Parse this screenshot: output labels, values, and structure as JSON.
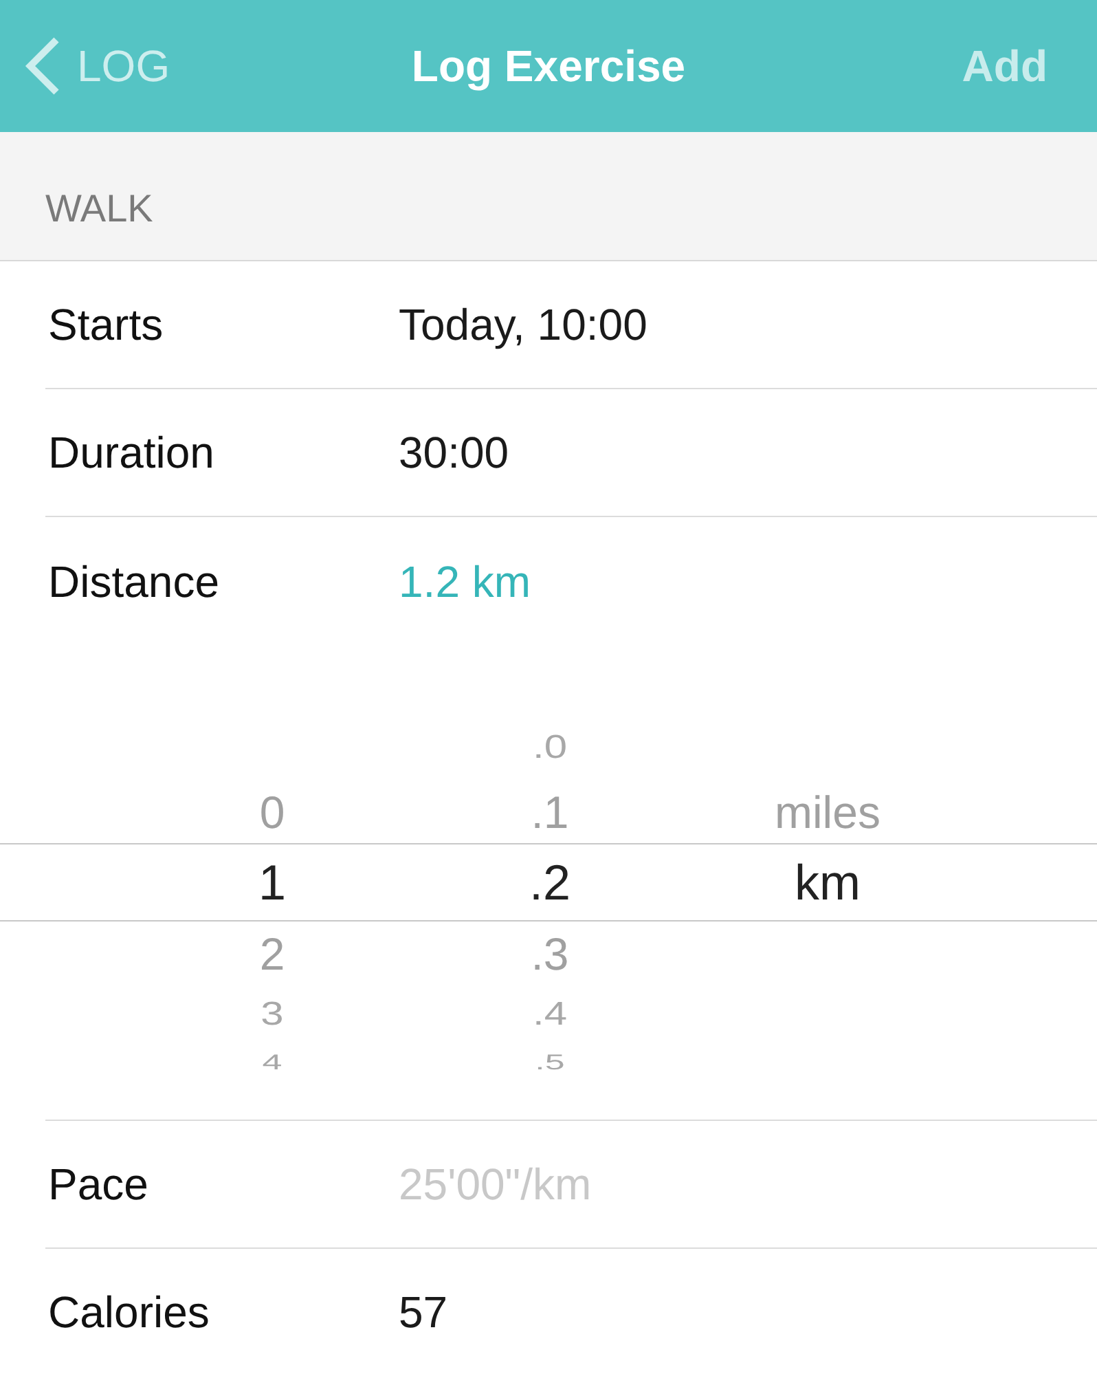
{
  "nav": {
    "back": {
      "label": "LOG"
    },
    "title": "Log Exercise",
    "action": {
      "label": "Add"
    }
  },
  "section": {
    "title": "WALK"
  },
  "rows": [
    {
      "label": "Starts",
      "value": "Today, 10:00",
      "selected": false,
      "disabled": false
    },
    {
      "label": "Duration",
      "value": "30:00",
      "selected": false,
      "disabled": false
    },
    {
      "label": "Distance",
      "value": "1.2 km",
      "selected": true,
      "disabled": false
    }
  ],
  "picker": {
    "columns": [
      {
        "items": [
          {
            "label": "0",
            "selected": false
          },
          {
            "label": "1",
            "selected": true
          },
          {
            "label": "2",
            "selected": false
          },
          {
            "label": "3",
            "selected": false
          },
          {
            "label": "4",
            "selected": false
          }
        ]
      },
      {
        "items": [
          {
            "label": ".0",
            "selected": false
          },
          {
            "label": ".1",
            "selected": false
          },
          {
            "label": ".2",
            "selected": true
          },
          {
            "label": ".3",
            "selected": false
          },
          {
            "label": ".4",
            "selected": false
          },
          {
            "label": ".5",
            "selected": false
          }
        ]
      },
      {
        "items": [
          {
            "label": "miles",
            "selected": false
          },
          {
            "label": "km",
            "selected": true
          }
        ]
      }
    ]
  },
  "summary_rows": [
    {
      "label": "Pace",
      "value": "25'00\"/km",
      "disabled": true
    },
    {
      "label": "Calories",
      "value": "57",
      "disabled": false
    }
  ]
}
